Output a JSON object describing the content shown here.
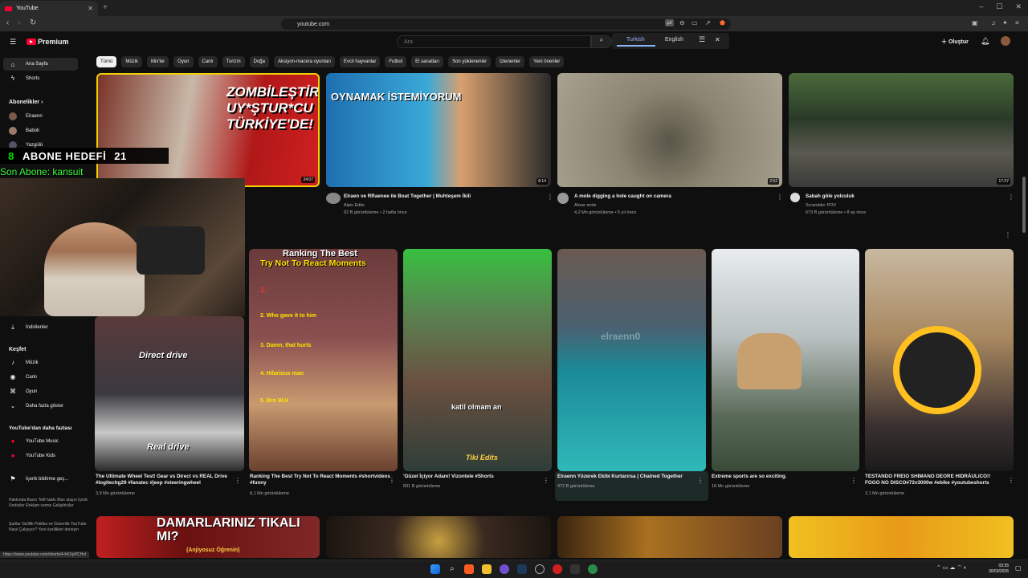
{
  "browser": {
    "tab_title": "YouTube",
    "url": "youtube.com",
    "status_url": "https://www.youtube.com/shorts/4-hKXpPCHvI"
  },
  "header": {
    "logo_text": "Premium",
    "search_placeholder": "Ara",
    "translate_from": "Turkish",
    "translate_to": "English",
    "create_label": "Oluştur"
  },
  "chips": [
    "Tümü",
    "Müzik",
    "Mix'ler",
    "Oyun",
    "Canlı",
    "Turizm",
    "Doğa",
    "Aksiyon-macera oyunları",
    "Evcil hayvanlar",
    "Futbol",
    "El sanatları",
    "Son yüklenenler",
    "İzlenenler",
    "Yeni öneriler"
  ],
  "sidebar": {
    "home": "Ana Sayfa",
    "shorts": "Shorts",
    "subs_title": "Abonelikler",
    "channels": [
      "Elraenn",
      "Baboli",
      "Yazgülü"
    ],
    "downloads": "İndirilenler",
    "explore_title": "Keşfet",
    "explore": [
      "Müzik",
      "Canlı",
      "Oyun",
      "Daha fazla göster"
    ],
    "more_title": "YouTube'dan daha fazlası",
    "more": [
      "YouTube Music",
      "YouTube Kids"
    ],
    "feedback": "İçerik bildirme geç...",
    "footer1": "Hakkında  Basın  Telif hakkı  Bize ulaşın  İçerik Üreticiler  Reklam verme  Geliştiriciler",
    "footer2": "Şartlar  Gizlilik  Politika ve Güvenlik  YouTube Nasıl Çalışıyor?  Yeni özellikleri deneyin"
  },
  "overlay": {
    "sub_goal_current": "8",
    "sub_goal_text": "ABONE HEDEFİ",
    "sub_goal_target": "21",
    "last_sub": "Son Abone: kansuit"
  },
  "row1": [
    {
      "overlay": "ZOMBİLEŞTİREN UY*ŞTUR*CU TÜRKİYE'DE!",
      "duration": "24:07"
    },
    {
      "overlay": "OYNAMAK İSTEMİYORUM",
      "duration": "8:14",
      "title": "Elraen ve RRaenee ile Boat Together | Muhteşem İkili",
      "channel": "Alpis Edits",
      "meta": "92 B görüntüleme • 2 hafta önce"
    },
    {
      "duration": "2:52",
      "title": "A mole digging a hole caught on camera",
      "channel": "Alone mole",
      "meta": "4,2 Mn görüntüleme • 5 yıl önce"
    },
    {
      "duration": "17:27",
      "title": "Sabah göle yolculuk",
      "channel": "Scrambler POV",
      "meta": "673 B görüntüleme • 8 ay önce"
    }
  ],
  "shorts": [
    {
      "overlay": [
        "Direct drive",
        "Real drive"
      ],
      "title": "The Ultimate Wheel Test! Gear vs Direct vs REAL Drive #logitechg29 #fanatec #jeep #steeringwheel",
      "meta": "3,9 Mn görüntüleme"
    },
    {
      "overlay": [
        "Ranking The Best",
        "Try Not To React Moments",
        "1.",
        "2. Who gave it to him",
        "3. Damn, that hurts",
        "4. Hilarious man",
        "5. Bro W.H"
      ],
      "title": "Ranking The Best Try Not To React Moments #shortvideos #funny",
      "meta": "8,1 Mn görüntüleme"
    },
    {
      "overlay": [
        "katil olmam an",
        "Tiki Edits"
      ],
      "title": "'Güzel İçiyor Adam! Vizontele #Shorts",
      "meta": "831 B görüntüleme"
    },
    {
      "overlay": [
        "elraenn0"
      ],
      "title": "Elraenn Yüzerek Ekibi Kurtarırsa | Chained Together",
      "meta": "472 B görüntüleme"
    },
    {
      "title": "Extreme sports are so exciting.",
      "meta": "18 Mn görüntüleme"
    },
    {
      "title": "TESTANDO FREIO SHIMANO DEORE HIDRÁULICO!! FOGO NO DISCO#72v3000w #ebike #youtubeshorts",
      "meta": "3,1 Mn görüntüleme"
    }
  ],
  "row3": [
    {
      "overlay": "DAMARLARINIZ TIKALI MI?",
      "sub": "(Anjiyosuz Öğrenin)"
    }
  ],
  "clock": {
    "time": "03:35",
    "date": "30/03/2026"
  }
}
